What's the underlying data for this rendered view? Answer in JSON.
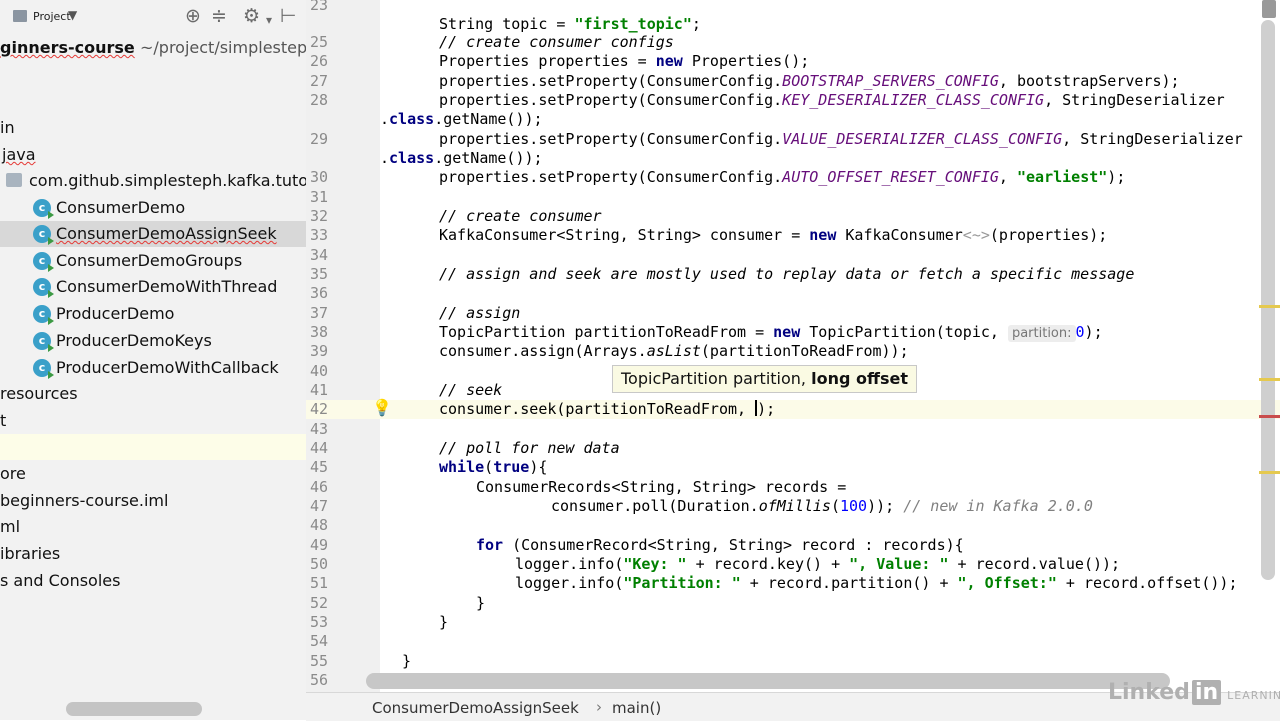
{
  "project_panel": {
    "toolbar_label": "Project",
    "tree": [
      {
        "label": "ginners-course",
        "suffix": "~/project/simplestep",
        "type": "root"
      },
      {
        "label": "in",
        "type": "folder"
      },
      {
        "label": "java",
        "type": "folder"
      },
      {
        "label": "com.github.simplesteph.kafka.tuto",
        "type": "package"
      },
      {
        "label": "ConsumerDemo",
        "type": "class"
      },
      {
        "label": "ConsumerDemoAssignSeek",
        "type": "class",
        "selected": true
      },
      {
        "label": "ConsumerDemoGroups",
        "type": "class"
      },
      {
        "label": "ConsumerDemoWithThread",
        "type": "class"
      },
      {
        "label": "ProducerDemo",
        "type": "class"
      },
      {
        "label": "ProducerDemoKeys",
        "type": "class"
      },
      {
        "label": "ProducerDemoWithCallback",
        "type": "class"
      },
      {
        "label": "resources",
        "type": "folder"
      },
      {
        "label": "t",
        "type": "folder"
      },
      {
        "label": "",
        "type": "empty"
      },
      {
        "label": "ore",
        "type": "file"
      },
      {
        "label": "beginners-course.iml",
        "type": "file"
      },
      {
        "label": "ml",
        "type": "file"
      },
      {
        "label": "ibraries",
        "type": "folder"
      },
      {
        "label": "s and Consoles",
        "type": "folder"
      }
    ]
  },
  "editor": {
    "line_numbers": [
      "23",
      "25",
      "26",
      "27",
      "28",
      "",
      "29",
      "",
      "30",
      "31",
      "32",
      "33",
      "34",
      "35",
      "36",
      "37",
      "38",
      "39",
      "40",
      "41",
      "42",
      "43",
      "44",
      "45",
      "46",
      "47",
      "48",
      "49",
      "50",
      "51",
      "52",
      "53",
      "54",
      "55",
      "56"
    ],
    "code": {
      "l23a": "String topic = ",
      "l23b": "\"first_topic\"",
      "l23c": ";",
      "l25": "// create consumer configs",
      "l26a": "Properties properties = ",
      "l26b": "new",
      "l26c": " Properties();",
      "l27a": "properties.setProperty(ConsumerConfig.",
      "l27b": "BOOTSTRAP_SERVERS_CONFIG",
      "l27c": ", bootstrapServers);",
      "l28a": "properties.setProperty(ConsumerConfig.",
      "l28b": "KEY_DESERIALIZER_CLASS_CONFIG",
      "l28c": ", StringDeserializer",
      "l28d1": ".",
      "l28d2": "class",
      "l28d3": ".getName());",
      "l29a": "properties.setProperty(ConsumerConfig.",
      "l29b": "VALUE_DESERIALIZER_CLASS_CONFIG",
      "l29c": ", StringDeserializer",
      "l29d1": ".",
      "l29d2": "class",
      "l29d3": ".getName());",
      "l30a": "properties.setProperty(ConsumerConfig.",
      "l30b": "AUTO_OFFSET_RESET_CONFIG",
      "l30c": ", ",
      "l30d": "\"earliest\"",
      "l30e": ");",
      "l32": "// create consumer",
      "l33a": "KafkaConsumer<String, String> consumer = ",
      "l33b": "new",
      "l33c": " KafkaConsumer",
      "l33d": "<~>",
      "l33e": "(properties);",
      "l35": "// assign and seek are mostly used to replay data or fetch a specific message",
      "l37": "// assign",
      "l38a": "TopicPartition partitionToReadFrom = ",
      "l38b": "new",
      "l38c": " TopicPartition(topic, ",
      "l38hint": "partition:",
      "l38d": "0",
      "l38e": ");",
      "l39a": "consumer.assign(Arrays.",
      "l39b": "asList",
      "l39c": "(partitionToReadFrom));",
      "l41": "// seek",
      "l42a": "consumer.seek(partitionToReadFrom, ",
      "l42b": ");",
      "l44": "// poll for new data",
      "l45a": "while",
      "l45b": "(",
      "l45c": "true",
      "l45d": "){",
      "l46": "ConsumerRecords<String, String> records =",
      "l47a": "consumer.poll(Duration.",
      "l47b": "ofMillis",
      "l47c": "(",
      "l47d": "100",
      "l47e": ")); ",
      "l47f": "// new in Kafka 2.0.0",
      "l49a": "for",
      "l49b": " (ConsumerRecord<String, String> record : records){",
      "l50a": "logger.info(",
      "l50b": "\"Key: \"",
      "l50c": " + record.key() + ",
      "l50d": "\", Value: \"",
      "l50e": " + record.value());",
      "l51a": "logger.info(",
      "l51b": "\"Partition: \"",
      "l51c": " + record.partition() + ",
      "l51d": "\", Offset:\"",
      "l51e": " + record.offset());",
      "l52": "}",
      "l53": "}",
      "l55": "}"
    },
    "tooltip": {
      "normal": "TopicPartition partition, ",
      "bold": "long offset"
    },
    "breadcrumb": {
      "class_name": "ConsumerDemoAssignSeek",
      "separator": "›",
      "method": "main()"
    },
    "watermark": {
      "linked": "Linked",
      "in": "in",
      "learning": "LEARNING"
    }
  },
  "colors": {
    "keyword": "#000080",
    "string": "#008000",
    "comment": "#808080",
    "constant": "#660e7a",
    "number": "#0000ff",
    "class_icon": "#3aa0c9",
    "current_line": "#fcfbe8",
    "stripe_warning": "#e5c94f",
    "stripe_error": "#c94c4c"
  },
  "icons": [
    "project-icon",
    "globe-icon",
    "collapse-icon",
    "gear-icon",
    "hide-icon",
    "class-icon",
    "package-icon",
    "lightbulb-icon"
  ]
}
